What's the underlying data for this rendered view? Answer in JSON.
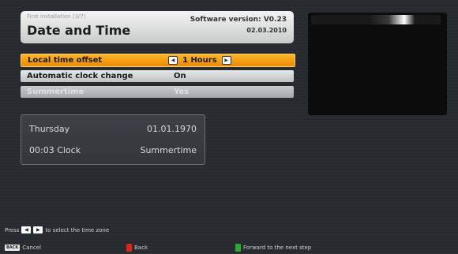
{
  "header": {
    "step": "First installation (3/7)",
    "title": "Date and Time",
    "software_version": "Software version: V0.23",
    "date": "02.03.2010"
  },
  "settings": [
    {
      "label": "Local time offset",
      "value": "1 Hours",
      "state": "selected"
    },
    {
      "label": "Automatic clock change",
      "value": "On",
      "state": "normal"
    },
    {
      "label": "Summertime",
      "value": "Yes",
      "state": "disabled"
    }
  ],
  "info_panel": {
    "weekday": "Thursday",
    "date": "01.01.1970",
    "time": "00:03 Clock",
    "mode": "Summertime"
  },
  "hint": {
    "prefix": "Press",
    "suffix": "to select the time zone"
  },
  "footer": {
    "cancel_key": "BACK",
    "cancel_label": "Cancel",
    "back_label": "Back",
    "forward_label": "Forward to the next step"
  },
  "colors": {
    "selected": "#f5a00f",
    "back_key": "#d32a1f",
    "forward_key": "#2fa43c"
  },
  "icons": {
    "left": "triangle-left",
    "right": "triangle-right"
  }
}
